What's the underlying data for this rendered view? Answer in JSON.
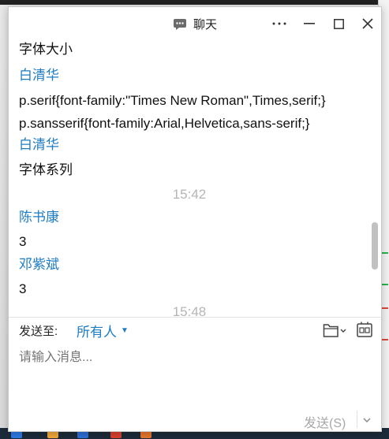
{
  "window": {
    "title": "聊天",
    "title_icon": "chat-bubble-icon",
    "controls": [
      "more-icon",
      "minimize-icon",
      "maximize-icon",
      "close-icon"
    ]
  },
  "messages": [
    {
      "kind": "text",
      "value": "字体大小"
    },
    {
      "kind": "sender",
      "value": "白清华"
    },
    {
      "kind": "text",
      "value": "p.serif{font-family:\"Times New Roman\",Times,serif;}"
    },
    {
      "kind": "text",
      "value": "p.sansserif{font-family:Arial,Helvetica,sans-serif;}"
    },
    {
      "kind": "sender",
      "value": "白清华"
    },
    {
      "kind": "text",
      "value": "字体系列"
    },
    {
      "kind": "time",
      "value": "15:42"
    },
    {
      "kind": "sender",
      "value": "陈书康"
    },
    {
      "kind": "text",
      "value": "3"
    },
    {
      "kind": "sender",
      "value": "邓紫斌"
    },
    {
      "kind": "text",
      "value": "3"
    },
    {
      "kind": "time",
      "value": "15:48"
    }
  ],
  "composer": {
    "send_to_label": "发送至:",
    "recipient": "所有人",
    "placeholder": "请输入消息...",
    "send_label": "发送(S)"
  },
  "colors": {
    "sender": "#1e7cc2",
    "timestamp": "#b5b5b5",
    "placeholder": "#c4c4c4"
  }
}
